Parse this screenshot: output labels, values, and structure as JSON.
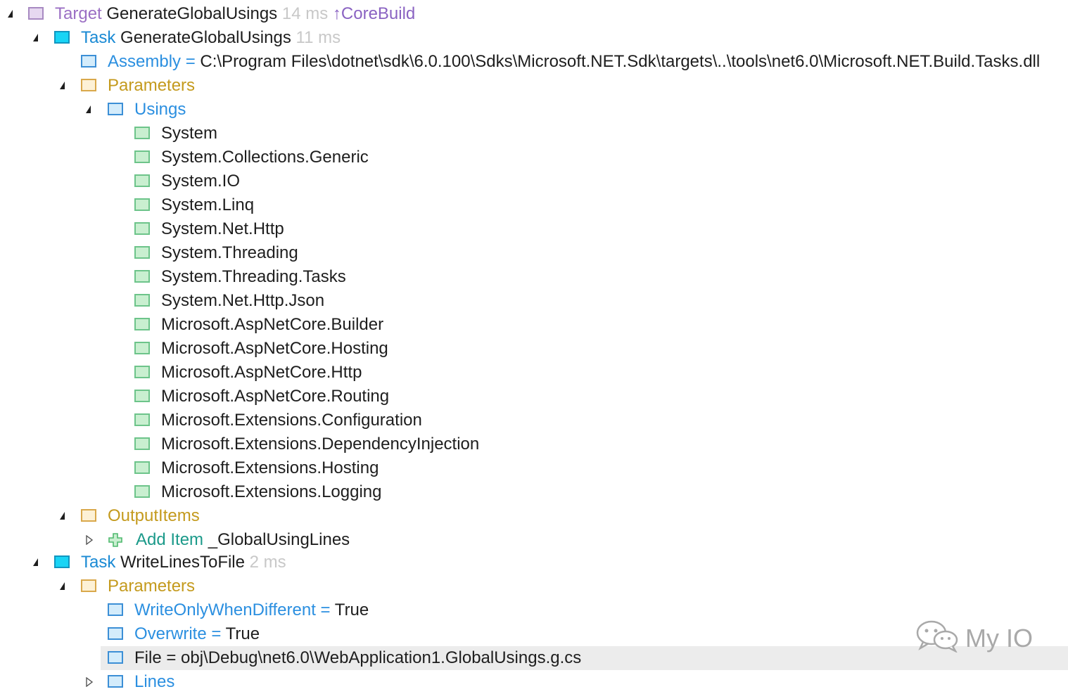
{
  "tree": {
    "target": {
      "kind": "Target",
      "name": "GenerateGlobalUsings",
      "duration": "14 ms",
      "arrow": "↑",
      "depends_on": "CoreBuild"
    },
    "task1": {
      "kind": "Task",
      "name": "GenerateGlobalUsings",
      "duration": "11 ms",
      "assembly": {
        "key": "Assembly",
        "eq": "=",
        "value": "C:\\Program Files\\dotnet\\sdk\\6.0.100\\Sdks\\Microsoft.NET.Sdk\\targets\\..\\tools\\net6.0\\Microsoft.NET.Build.Tasks.dll"
      },
      "parameters_label": "Parameters",
      "usings_label": "Usings",
      "usings": [
        "System",
        "System.Collections.Generic",
        "System.IO",
        "System.Linq",
        "System.Net.Http",
        "System.Threading",
        "System.Threading.Tasks",
        "System.Net.Http.Json",
        "Microsoft.AspNetCore.Builder",
        "Microsoft.AspNetCore.Hosting",
        "Microsoft.AspNetCore.Http",
        "Microsoft.AspNetCore.Routing",
        "Microsoft.Extensions.Configuration",
        "Microsoft.Extensions.DependencyInjection",
        "Microsoft.Extensions.Hosting",
        "Microsoft.Extensions.Logging"
      ],
      "output_items_label": "OutputItems",
      "add_item": {
        "kind": "Add Item",
        "name": "_GlobalUsingLines"
      }
    },
    "task2": {
      "kind": "Task",
      "name": "WriteLinesToFile",
      "duration": "2 ms",
      "parameters_label": "Parameters",
      "params": [
        {
          "key": "WriteOnlyWhenDifferent",
          "eq": "=",
          "value": "True"
        },
        {
          "key": "Overwrite",
          "eq": "=",
          "value": "True"
        },
        {
          "key": "File",
          "eq": "=",
          "value": "obj\\Debug\\net6.0\\WebApplication1.GlobalUsings.g.cs"
        }
      ],
      "lines_label": "Lines"
    }
  },
  "watermark": {
    "text": "My IO"
  },
  "colors": {
    "target_kw": "#9b6fc4",
    "task_kw": "#1a8ad4",
    "property_kw": "#2b8fe0",
    "folder_kw": "#c49a1d",
    "add_kw": "#1c9a8a",
    "selection": "#ececec"
  }
}
